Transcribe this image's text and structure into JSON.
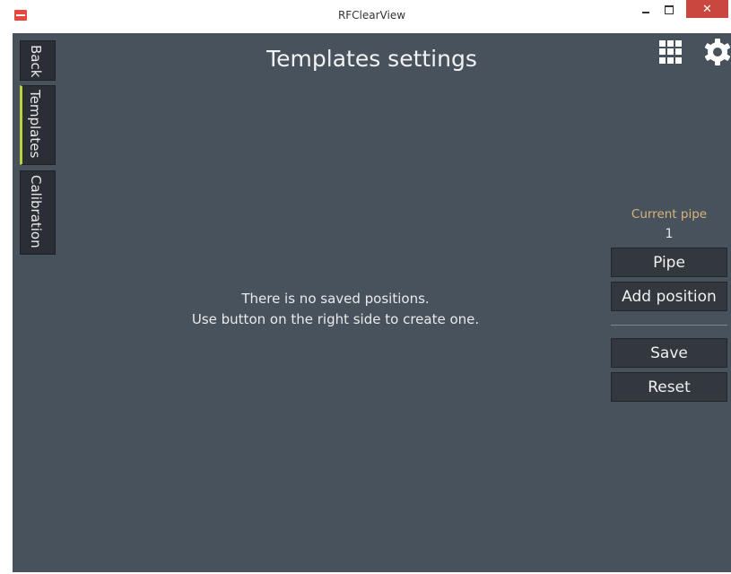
{
  "window": {
    "title": "RFClearView",
    "close_glyph": "✕"
  },
  "sidebar": {
    "tabs": [
      {
        "label": "Back"
      },
      {
        "label": "Templates",
        "active": true
      },
      {
        "label": "Calibration"
      }
    ]
  },
  "header": {
    "title": "Templates settings",
    "icons": [
      "grid-apps-icon",
      "gear-icon"
    ]
  },
  "main": {
    "empty_line1": "There is no saved positions.",
    "empty_line2": "Use button on the right side to create one."
  },
  "right_panel": {
    "current_pipe_label": "Current pipe",
    "current_pipe_value": "1",
    "pipe_button": "Pipe",
    "add_position_button": "Add position",
    "save_button": "Save",
    "reset_button": "Reset"
  },
  "colors": {
    "background": "#48525d",
    "accent": "#b9d33f",
    "current_pipe_label": "#d8b47a",
    "close_button": "#c9473f"
  }
}
